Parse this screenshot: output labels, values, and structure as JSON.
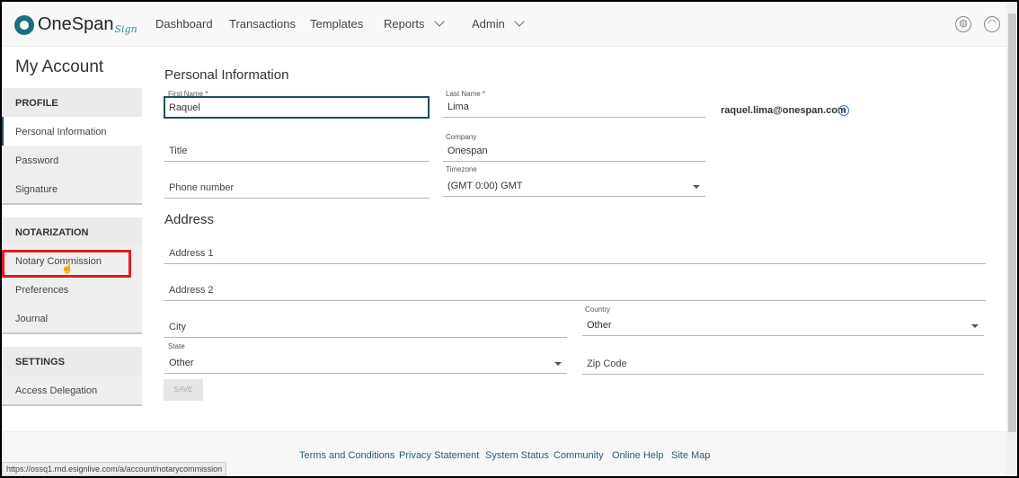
{
  "header": {
    "logo": "OneSpan",
    "logo_sub": "Sign",
    "nav": [
      "Dashboard",
      "Transactions",
      "Templates",
      "Reports",
      "Admin"
    ]
  },
  "sidebar": {
    "title": "My Account",
    "sections": [
      {
        "label": "PROFILE",
        "items": [
          "Personal Information",
          "Password",
          "Signature"
        ]
      },
      {
        "label": "NOTARIZATION",
        "items": [
          "Notary Commission",
          "Preferences",
          "Journal"
        ]
      },
      {
        "label": "SETTINGS",
        "items": [
          "Access Delegation"
        ]
      }
    ],
    "active": "Personal Information",
    "highlighted": "Notary Commission"
  },
  "form": {
    "personal_title": "Personal Information",
    "first_name": {
      "label": "First Name *",
      "value": "Raquel"
    },
    "last_name": {
      "label": "Last Name *",
      "value": "Lima"
    },
    "email": "raquel.lima@onespan.com",
    "title": {
      "placeholder": "Title"
    },
    "company": {
      "label": "Company",
      "value": "Onespan"
    },
    "phone": {
      "placeholder": "Phone number"
    },
    "timezone": {
      "label": "Timezone",
      "value": "(GMT 0:00) GMT"
    },
    "address_title": "Address",
    "address1": {
      "placeholder": "Address 1"
    },
    "address2": {
      "placeholder": "Address 2"
    },
    "city": {
      "placeholder": "City"
    },
    "country": {
      "label": "Country",
      "value": "Other"
    },
    "state": {
      "label": "State",
      "value": "Other"
    },
    "zip": {
      "placeholder": "Zip Code"
    },
    "save": "SAVE"
  },
  "footer": {
    "links": [
      "Terms and Conditions",
      "Privacy Statement",
      "System Status",
      "Community",
      "Online Help",
      "Site Map"
    ]
  },
  "status_url": "https://ossq1.rnd.esignlive.com/a/account/notarycommission",
  "colors": {
    "brand": "#1e6f7d",
    "highlight": "#e21b23",
    "link": "#2a5d75"
  }
}
